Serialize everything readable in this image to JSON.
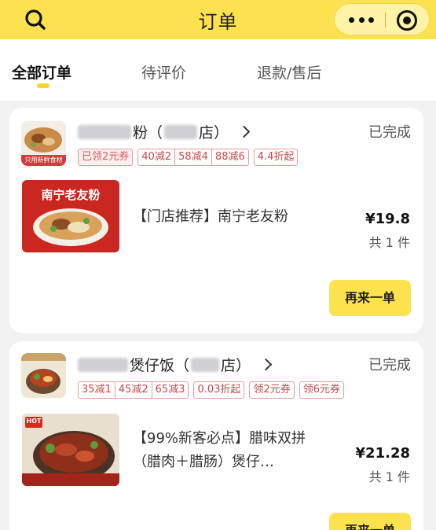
{
  "header": {
    "title": "订单"
  },
  "tabs": [
    {
      "label": "全部订单"
    },
    {
      "label": "待评价"
    },
    {
      "label": "退款/售后"
    }
  ],
  "orders": [
    {
      "store_name_partial": "粉（",
      "store_name_suffix": "店）",
      "status": "已完成",
      "logo_text": "只用新鲜食材",
      "tags": [
        "已领2元券",
        "40减2",
        "58减4",
        "88减6",
        "4.4折起"
      ],
      "product_image_title": "南宁老友粉",
      "product_name": "【门店推荐】南宁老友粉",
      "price": "¥19.8",
      "quantity": "共 1 件",
      "reorder_label": "再来一单"
    },
    {
      "store_name_partial": "煲仔饭（",
      "store_name_suffix": "店）",
      "status": "已完成",
      "tags": [
        "35减1",
        "45减2",
        "65减3",
        "0.03折起",
        "领2元券",
        "领6元券"
      ],
      "product_image_badge": "HOT",
      "product_name": "【99%新客必点】腊味双拼（腊肉＋腊肠）煲仔…",
      "price": "¥21.28",
      "quantity": "共 1 件",
      "reorder_label": "再来一单"
    }
  ],
  "colors": {
    "brand_yellow": "#fde250",
    "tag_red": "#c54a4a"
  }
}
